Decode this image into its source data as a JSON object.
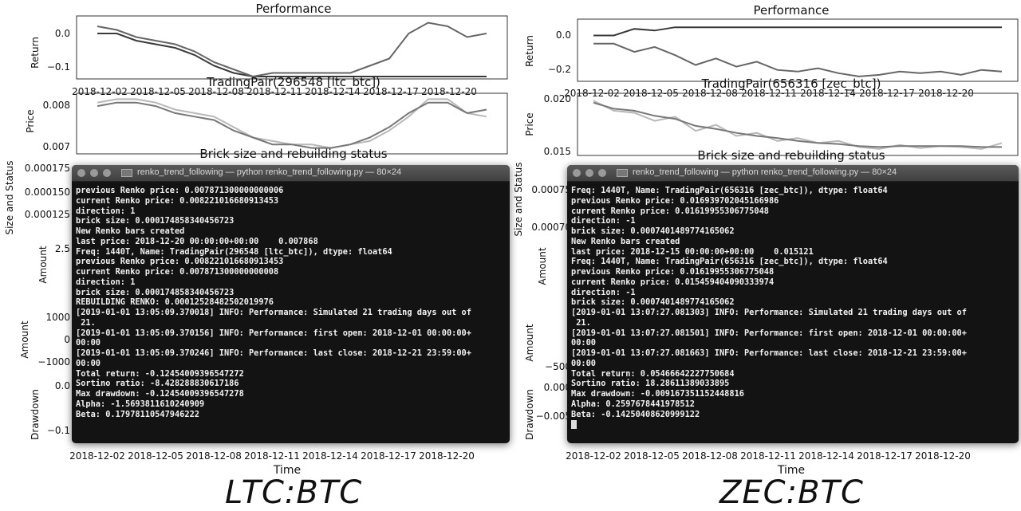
{
  "left": {
    "terminal": {
      "title": "renko_trend_following — python renko_trend_following.py — 80×24",
      "lines": [
        "previous Renko price: 0.007871300000000006",
        "current Renko price: 0.008221016680913453",
        "direction: 1",
        "brick size: 0.00017485834045672З",
        "New Renko bars created",
        "last price: 2018-12-20 00:00:00+00:00    0.007868",
        "Freq: 1440T, Name: TradingPair(296548 [ltc_btc]), dtype: float64",
        "previous Renko price: 0.008221016680913453",
        "current Renko price: 0.007871300000000008",
        "direction: 1",
        "brick size: 0.000174858340456723",
        "REBUILDING RENKO: 0.00012528482502019976",
        "[2019-01-01 13:05:09.370018] INFO: Performance: Simulated 21 trading days out of",
        " 21.",
        "[2019-01-01 13:05:09.370156] INFO: Performance: first open: 2018-12-01 00:00:00+",
        "00:00",
        "[2019-01-01 13:05:09.370246] INFO: Performance: last close: 2018-12-21 23:59:00+",
        "00:00",
        "Total return: -0.12454009396547272",
        "Sortino ratio: -8.428288830617186",
        "Max drawdown: -0.12454009396547278",
        "Alpha: -1.5693811610240909",
        "Beta: 0.17978110547946222"
      ]
    },
    "charts": {
      "performance_title": "Performance",
      "return_label": "Return",
      "return_ticks": [
        "0.0",
        "−0.1"
      ],
      "pair_title": "TradingPair(296548 [ltc_btc])",
      "price_label": "Price",
      "price_ticks": [
        "0.008",
        "0.007"
      ],
      "brick_title": "Brick size and rebuilding status",
      "brick_label": "Size and Status",
      "brick_ticks": [
        "0.000175",
        "0.000150",
        "0.000125"
      ],
      "amount_label": "Amount",
      "amount_ticks": [
        "2.5"
      ],
      "amount2_label": "Amount",
      "amount2_ticks": [
        "1000",
        "0",
        "−1000"
      ],
      "drawdown_label": "Drawdown",
      "drawdown_ticks": [
        "0.0",
        "−0.1"
      ],
      "date_ticks_top": [
        "2018-12-02",
        "2018-12-05",
        "2018-12-08",
        "2018-12-11",
        "2018-12-14",
        "2018-12-17",
        "2018-12-20"
      ],
      "date_ticks": [
        "2018-12-02",
        "2018-12-05",
        "2018-12-08",
        "2018-12-11",
        "2018-12-14",
        "2018-12-17",
        "2018-12-20"
      ],
      "time_label": "Time"
    },
    "caption": "LTC:BTC"
  },
  "right": {
    "terminal": {
      "title": "renko_trend_following — python renko_trend_following.py — 80×24",
      "lines": [
        "Freq: 1440T, Name: TradingPair(656316 [zec_btc]), dtype: float64",
        "previous Renko price: 0.016939702045166986",
        "current Renko price: 0.01619955306775048",
        "direction: -1",
        "brick size: 0.0007401489774165062",
        "New Renko bars created",
        "last price: 2018-12-15 00:00:00+00:00    0.015121",
        "Freq: 1440T, Name: TradingPair(656316 [zec_btc]), dtype: float64",
        "previous Renko price: 0.01619955306775048",
        "current Renko price: 0.015459404090333974",
        "direction: -1",
        "brick size: 0.0007401489774165062",
        "[2019-01-01 13:07:27.081303] INFO: Performance: Simulated 21 trading days out of",
        " 21.",
        "[2019-01-01 13:07:27.081501] INFO: Performance: first open: 2018-12-01 00:00:00+",
        "00:00",
        "[2019-01-01 13:07:27.081663] INFO: Performance: last close: 2018-12-21 23:59:00+",
        "00:00",
        "Total return: 0.05466642227750684",
        "Sortino ratio: 18.28611389033895",
        "Max drawdown: -0.009167351152448816",
        "Alpha: 0.2597678441978512",
        "Beta: -0.14250408620999122"
      ]
    },
    "charts": {
      "performance_title": "Performance",
      "return_label": "Return",
      "return_ticks": [
        "0.0",
        "−0.2"
      ],
      "pair_title": "TradingPair(656316 [zec_btc])",
      "price_label": "Price",
      "price_ticks": [
        "0.020",
        "0.015"
      ],
      "brick_title": "Brick size and rebuilding status",
      "brick_label": "Size and Status",
      "brick_ticks": [
        "0.00075",
        "0.00070"
      ],
      "amount_label": "Amount",
      "amount_ticks": [],
      "amount2_label": "Amount",
      "amount2_ticks": [
        "−500"
      ],
      "drawdown_label": "Drawdown",
      "drawdown_ticks": [
        "0.000",
        "−0.005"
      ],
      "date_ticks_top": [
        "2018-12-02",
        "2018-12-05",
        "2018-12-08",
        "2018-12-11",
        "2018-12-14",
        "2018-12-17",
        "2018-12-20"
      ],
      "date_ticks": [
        "2018-12-02",
        "2018-12-05",
        "2018-12-08",
        "2018-12-11",
        "2018-12-14",
        "2018-12-17",
        "2018-12-20"
      ],
      "time_label": "Time"
    },
    "caption": "ZEC:BTC"
  },
  "chart_data": [
    {
      "type": "line",
      "title": "Performance",
      "ylabel": "Return",
      "x": [
        "2018-12-01",
        "2018-12-02",
        "2018-12-03",
        "2018-12-04",
        "2018-12-05",
        "2018-12-06",
        "2018-12-07",
        "2018-12-08",
        "2018-12-09",
        "2018-12-10",
        "2018-12-11",
        "2018-12-12",
        "2018-12-13",
        "2018-12-14",
        "2018-12-15",
        "2018-12-16",
        "2018-12-17",
        "2018-12-18",
        "2018-12-19",
        "2018-12-20",
        "2018-12-21"
      ],
      "series": [
        {
          "values": [
            0.0,
            0.0,
            -0.02,
            -0.03,
            -0.04,
            -0.06,
            -0.09,
            -0.11,
            -0.12,
            -0.12,
            -0.12,
            -0.12,
            -0.12,
            -0.12,
            -0.12,
            -0.12,
            -0.12,
            -0.12,
            -0.12,
            -0.12,
            -0.12
          ]
        },
        {
          "values": [
            0.02,
            0.01,
            -0.01,
            -0.02,
            -0.03,
            -0.05,
            -0.08,
            -0.1,
            -0.12,
            -0.11,
            -0.11,
            -0.11,
            -0.11,
            -0.11,
            -0.09,
            -0.07,
            0.0,
            0.03,
            0.02,
            -0.01,
            0.0
          ]
        }
      ],
      "ylim": [
        -0.12,
        0.04
      ]
    },
    {
      "type": "line",
      "title": "TradingPair(296548 [ltc_btc])",
      "ylabel": "Price",
      "x": [
        "2018-12-01",
        "2018-12-02",
        "2018-12-03",
        "2018-12-04",
        "2018-12-05",
        "2018-12-06",
        "2018-12-07",
        "2018-12-08",
        "2018-12-09",
        "2018-12-10",
        "2018-12-11",
        "2018-12-12",
        "2018-12-13",
        "2018-12-14",
        "2018-12-15",
        "2018-12-16",
        "2018-12-17",
        "2018-12-18",
        "2018-12-19",
        "2018-12-20",
        "2018-12-21"
      ],
      "series": [
        {
          "values": [
            0.0082,
            0.0083,
            0.0083,
            0.0082,
            0.008,
            0.0079,
            0.0078,
            0.0075,
            0.0072,
            0.0071,
            0.007,
            0.007,
            0.0069,
            0.007,
            0.0071,
            0.0074,
            0.0078,
            0.0083,
            0.0083,
            0.0079,
            0.0078
          ]
        },
        {
          "values": [
            0.0081,
            0.0082,
            0.0082,
            0.0081,
            0.0079,
            0.0078,
            0.0077,
            0.0074,
            0.0072,
            0.007,
            0.007,
            0.0069,
            0.0069,
            0.007,
            0.0072,
            0.0075,
            0.0079,
            0.0082,
            0.0082,
            0.0079,
            0.008
          ]
        }
      ],
      "ylim": [
        0.0068,
        0.0084
      ]
    },
    {
      "type": "line",
      "title": "Performance",
      "ylabel": "Return",
      "x": [
        "2018-12-01",
        "2018-12-02",
        "2018-12-03",
        "2018-12-04",
        "2018-12-05",
        "2018-12-06",
        "2018-12-07",
        "2018-12-08",
        "2018-12-09",
        "2018-12-10",
        "2018-12-11",
        "2018-12-12",
        "2018-12-13",
        "2018-12-14",
        "2018-12-15",
        "2018-12-16",
        "2018-12-17",
        "2018-12-18",
        "2018-12-19",
        "2018-12-20",
        "2018-12-21"
      ],
      "series": [
        {
          "values": [
            0.0,
            0.0,
            0.04,
            0.03,
            0.05,
            0.05,
            0.05,
            0.05,
            0.05,
            0.05,
            0.05,
            0.05,
            0.05,
            0.05,
            0.05,
            0.05,
            0.05,
            0.05,
            0.05,
            0.05,
            0.05
          ]
        },
        {
          "values": [
            -0.05,
            -0.05,
            -0.1,
            -0.07,
            -0.12,
            -0.18,
            -0.14,
            -0.19,
            -0.16,
            -0.21,
            -0.22,
            -0.2,
            -0.23,
            -0.25,
            -0.24,
            -0.22,
            -0.23,
            -0.22,
            -0.24,
            -0.21,
            -0.22
          ]
        }
      ],
      "ylim": [
        -0.26,
        0.08
      ]
    },
    {
      "type": "line",
      "title": "TradingPair(656316 [zec_btc])",
      "ylabel": "Price",
      "x": [
        "2018-12-01",
        "2018-12-02",
        "2018-12-03",
        "2018-12-04",
        "2018-12-05",
        "2018-12-06",
        "2018-12-07",
        "2018-12-08",
        "2018-12-09",
        "2018-12-10",
        "2018-12-11",
        "2018-12-12",
        "2018-12-13",
        "2018-12-14",
        "2018-12-15",
        "2018-12-16",
        "2018-12-17",
        "2018-12-18",
        "2018-12-19",
        "2018-12-20",
        "2018-12-21"
      ],
      "series": [
        {
          "values": [
            0.02,
            0.019,
            0.0188,
            0.018,
            0.0184,
            0.017,
            0.0176,
            0.0165,
            0.0168,
            0.016,
            0.0163,
            0.0158,
            0.016,
            0.0154,
            0.0152,
            0.0156,
            0.0153,
            0.0155,
            0.0154,
            0.0152,
            0.0158
          ]
        },
        {
          "values": [
            0.0198,
            0.0192,
            0.019,
            0.0185,
            0.0182,
            0.0175,
            0.0172,
            0.0168,
            0.0165,
            0.0163,
            0.016,
            0.0158,
            0.0157,
            0.0155,
            0.0154,
            0.0155,
            0.0155,
            0.0155,
            0.0155,
            0.0154,
            0.0154
          ]
        }
      ],
      "ylim": [
        0.0148,
        0.0205
      ]
    }
  ]
}
